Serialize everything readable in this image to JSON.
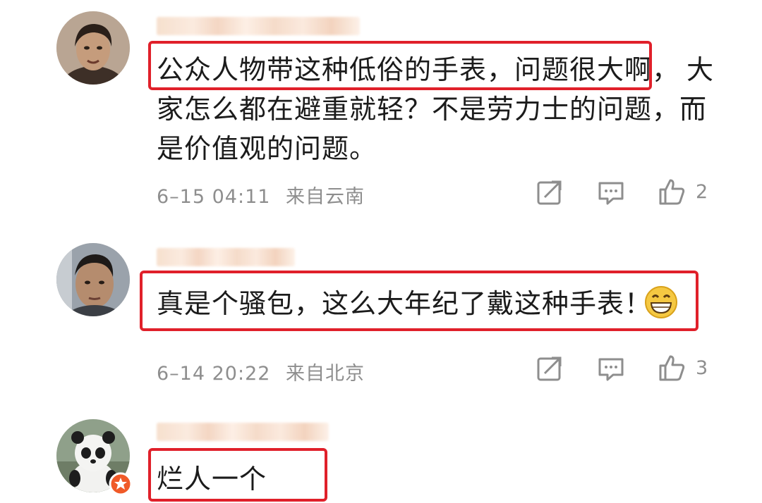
{
  "comments": [
    {
      "text_line1_highlight": "公众人物带这种低俗的手表，问题很大啊，",
      "text_line1_rest": "大",
      "text_line2": "家怎么都在避重就轻？不是劳力士的问题，而",
      "text_line3": "是价值观的问题。",
      "timestamp": "6–15 04:11",
      "location": "来自云南",
      "like_count": "2"
    },
    {
      "text": "真是个骚包，这么大年纪了戴这种手表！",
      "emoji": "grinning-emoji",
      "timestamp": "6–14 20:22",
      "location": "来自北京",
      "like_count": "3"
    },
    {
      "text": "烂人一个"
    }
  ],
  "colors": {
    "highlight": "#e0202a",
    "meta_text": "#8e8e8e",
    "badge": "#f05a28"
  },
  "icons": [
    "share-icon",
    "comment-icon",
    "like-icon"
  ]
}
